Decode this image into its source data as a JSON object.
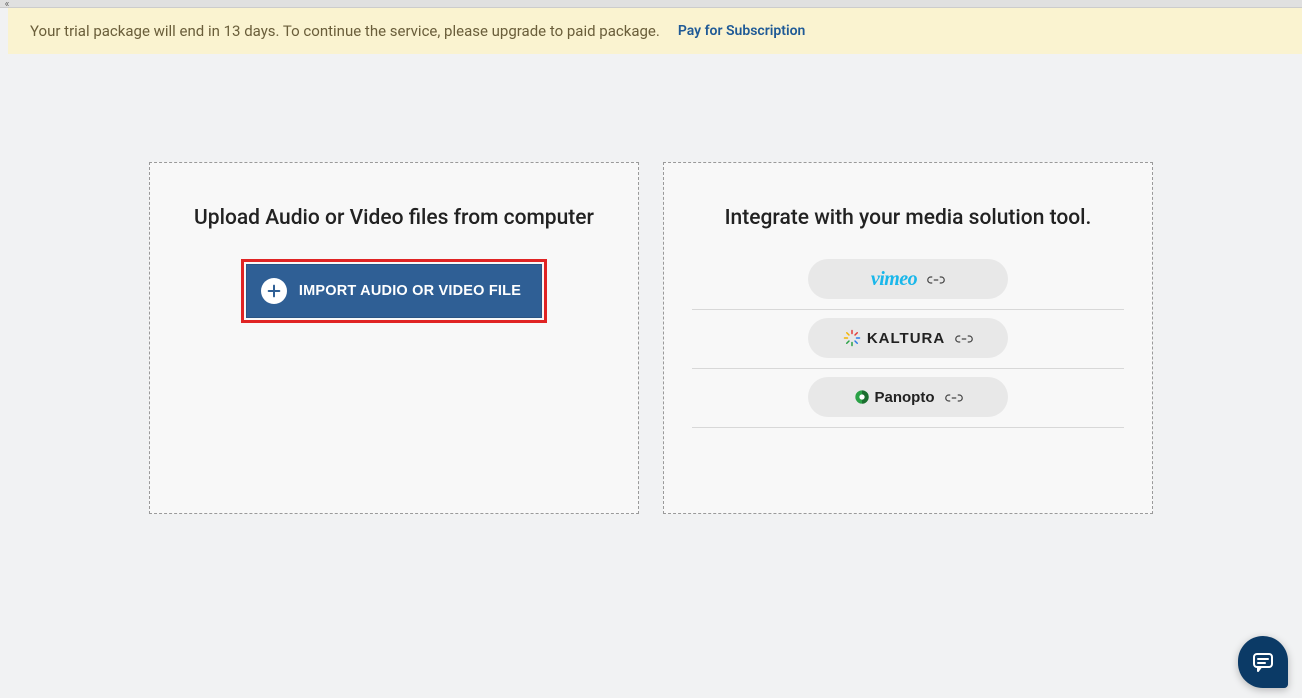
{
  "banner": {
    "message": "Your trial package will end in 13 days. To continue the service, please upgrade to paid package.",
    "link_label": "Pay for Subscription"
  },
  "upload_panel": {
    "heading": "Upload Audio or Video files from computer",
    "button_label": "IMPORT AUDIO OR VIDEO FILE"
  },
  "integrate_panel": {
    "heading": "Integrate with your media solution tool.",
    "providers": {
      "vimeo": "vimeo",
      "kaltura": "KALTURA",
      "panopto": "Panopto"
    }
  },
  "icons": {
    "collapse": "«",
    "plus": "plus-icon",
    "link": "link-icon",
    "chat": "chat-icon"
  }
}
